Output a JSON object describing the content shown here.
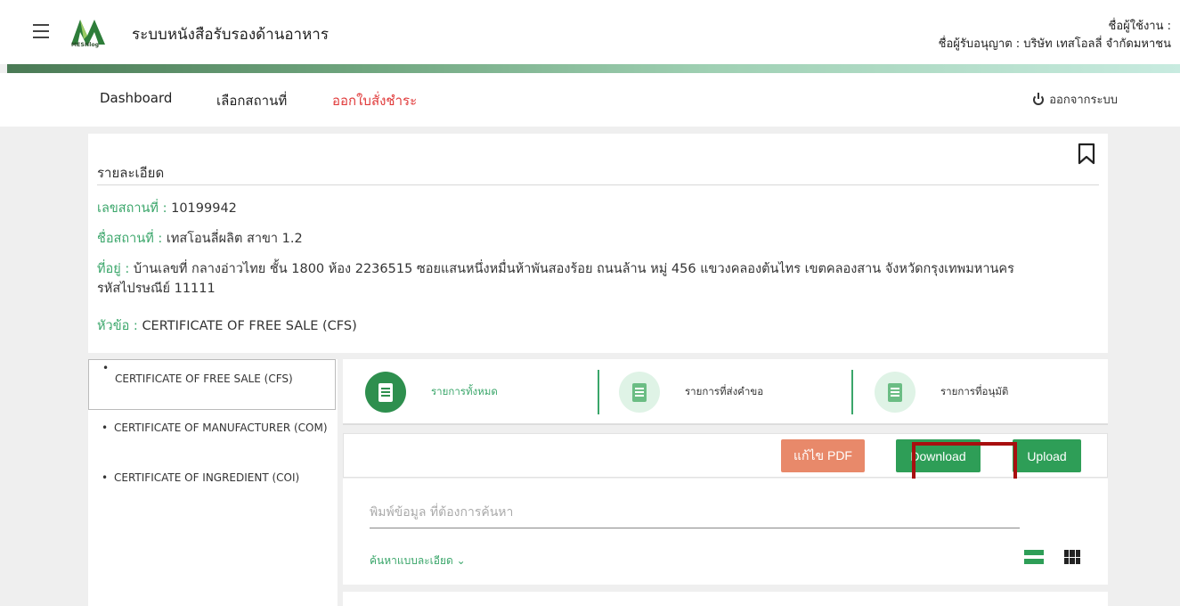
{
  "header": {
    "app_title": "ระบบหนังสือรับรองด้านอาหาร",
    "logo_text": "MESHlog",
    "user_label": "ชื่อผู้ใช้งาน :",
    "licensee_label": "ชื่อผู้รับอนุญาต : บริษัท เทสโอลลี่ จำกัดมหาชน"
  },
  "nav": {
    "items": [
      {
        "label": "Dashboard"
      },
      {
        "label": "เลือกสถานที่"
      },
      {
        "label": "ออกใบสั่งชำระ"
      }
    ],
    "logout_label": "ออกจากระบบ"
  },
  "detail": {
    "title": "รายละเอียด",
    "place_no_label": "เลขสถานที่ :",
    "place_no_value": "10199942",
    "place_name_label": "ชื่อสถานที่ :",
    "place_name_value": "เทสโอนลี่ผลิต สาขา 1.2",
    "address_label": "ที่อยู่ :",
    "address_value": "บ้านเลขที่ กลางอ่าวไทย ชั้น 1800 ห้อง 2236515 ซอยแสนหนึ่งหมื่นห้าพันสองร้อย ถนนล้าน หมู่ 456 แขวงคลองต้นไทร เขตคลองสาน จังหวัดกรุงเทพมหานคร",
    "postal_value": "รหัสไปรษณีย์ 11111",
    "topic_label": "หัวข้อ :",
    "topic_value": "CERTIFICATE OF FREE SALE (CFS)"
  },
  "certificates": [
    {
      "label": "CERTIFICATE OF FREE SALE (CFS)"
    },
    {
      "label": "CERTIFICATE OF MANUFACTURER (COM)"
    },
    {
      "label": "CERTIFICATE OF INGREDIENT (COI)"
    }
  ],
  "stats": [
    {
      "label": "รายการทั้งหมด"
    },
    {
      "label": "รายการที่ส่งคำขอ"
    },
    {
      "label": "รายการที่อนุมัติ"
    }
  ],
  "actions": {
    "edit_pdf": "แก้ไข PDF",
    "download": "Download",
    "upload": "Upload"
  },
  "search": {
    "placeholder": "พิมพ์ข้อมูล ที่ต้องการค้นหา",
    "advanced_label": "ค้นหาแบบละเอียด ⌄"
  },
  "colors": {
    "accent_green": "#2e9e57",
    "label_green": "#3aa66a",
    "nav_active": "#e03a3a",
    "pdf_button": "#e8896a",
    "highlight": "#a80f0f"
  }
}
